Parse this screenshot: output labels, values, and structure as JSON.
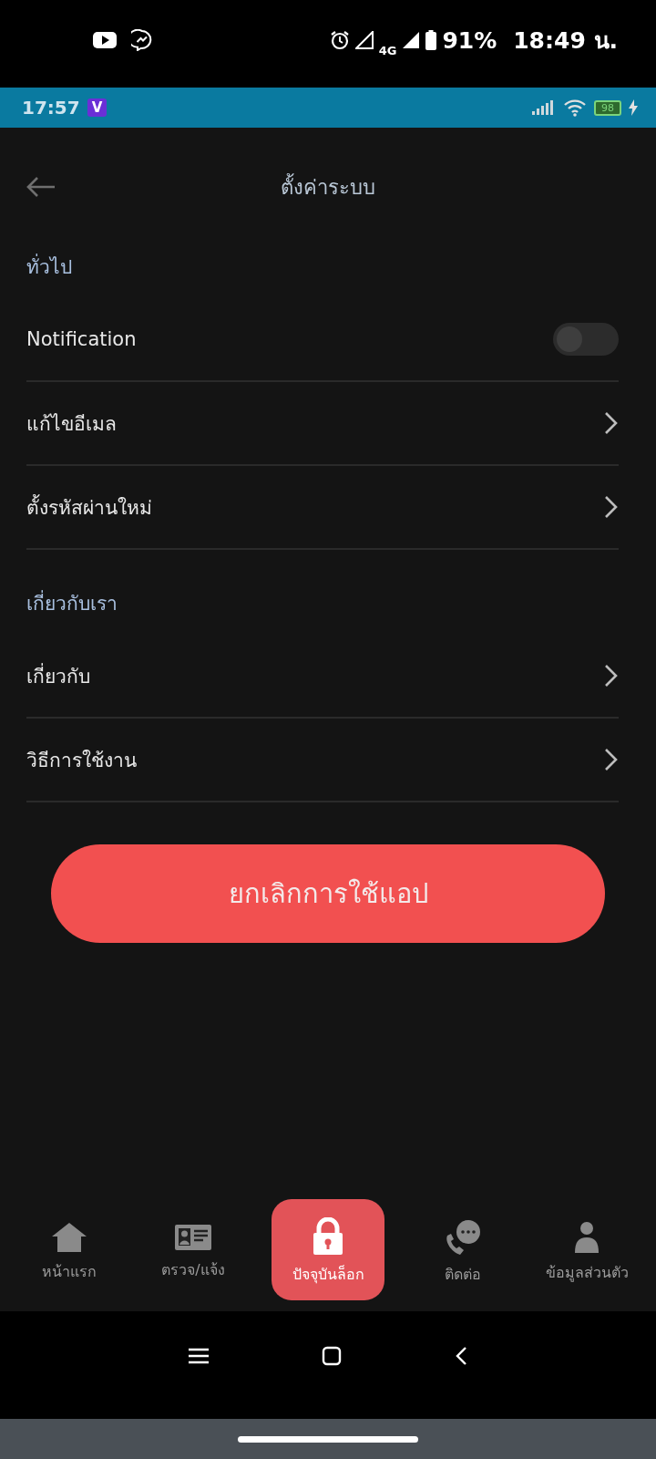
{
  "phone_status": {
    "network": "4G",
    "battery": "91%",
    "time": "18:49 น."
  },
  "app_status": {
    "time": "17:57",
    "badge": "V",
    "battery": "98"
  },
  "header": {
    "title": "ตั้งค่าระบบ"
  },
  "sections": [
    {
      "title": "ทั่วไป",
      "items": [
        {
          "label": "Notification",
          "kind": "toggle",
          "on": false
        },
        {
          "label": "แก้ไขอีเมล",
          "kind": "link"
        },
        {
          "label": "ตั้งรหัสผ่านใหม่",
          "kind": "link"
        }
      ]
    },
    {
      "title": "เกี่ยวกับเรา",
      "items": [
        {
          "label": "เกี่ยวกับ",
          "kind": "link"
        },
        {
          "label": "วิธีการใช้งาน",
          "kind": "link"
        }
      ]
    }
  ],
  "cancel_button": "ยกเลิกการใช้แอป",
  "bottom_nav": [
    {
      "label": "หน้าแรก",
      "kind": "home",
      "selected": false
    },
    {
      "label": "ตรวจ/แจ้ง",
      "kind": "card",
      "selected": false
    },
    {
      "label": "ปัจจุบันล็อก",
      "kind": "lock",
      "selected": true
    },
    {
      "label": "ติดต่อ",
      "kind": "contact",
      "selected": false
    },
    {
      "label": "ข้อมูลส่วนตัว",
      "kind": "person",
      "selected": false
    }
  ]
}
